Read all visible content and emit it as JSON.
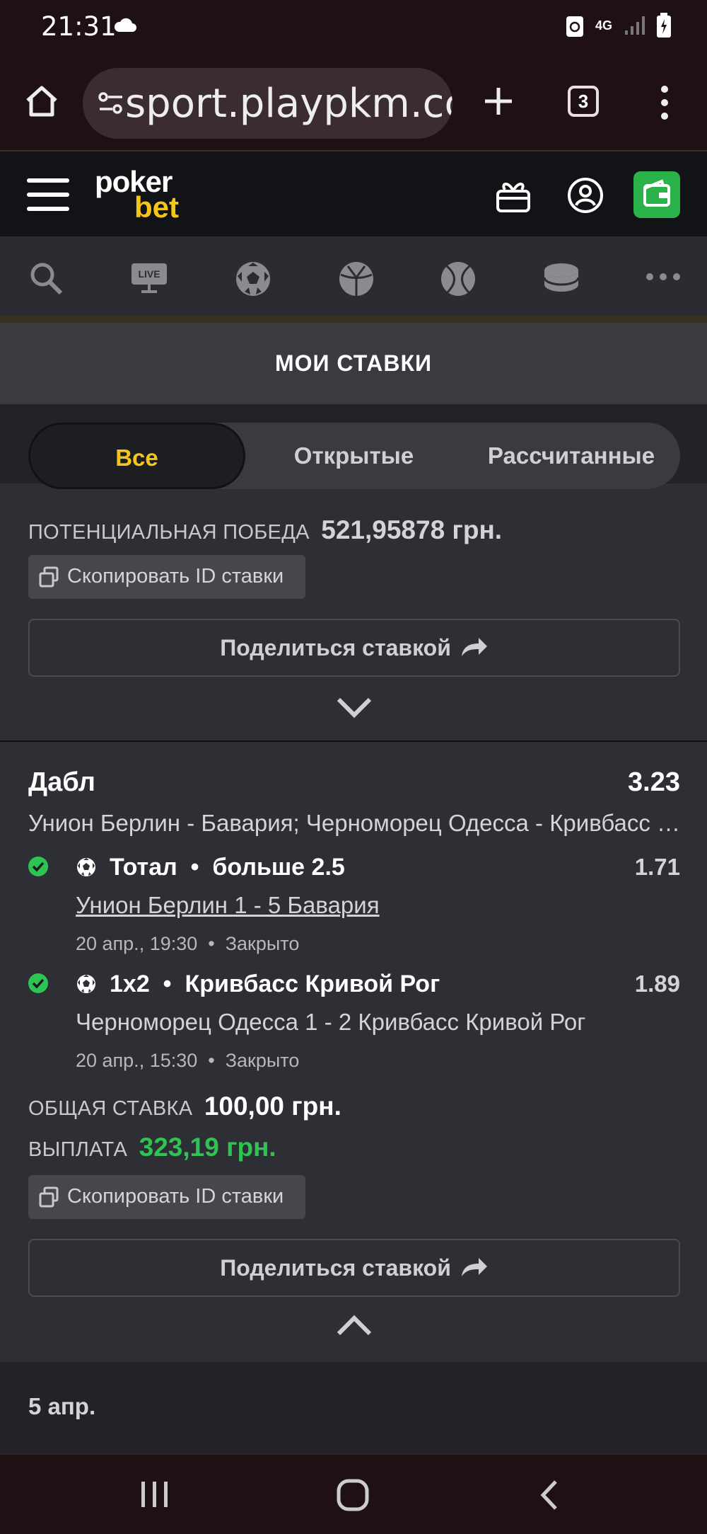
{
  "status_bar": {
    "time": "21:31",
    "network": "4G"
  },
  "browser": {
    "url": "sport.playpkm.cc",
    "tab_count": "3"
  },
  "site": {
    "logo_top": "poker",
    "logo_bottom": "bet"
  },
  "sport_nav": {
    "live_label": "LIVE"
  },
  "modal": {
    "title": "МОИ СТАВКИ",
    "tabs": [
      {
        "label": "Все",
        "active": true
      },
      {
        "label": "Открытые",
        "active": false
      },
      {
        "label": "Рассчитанные",
        "active": false
      }
    ]
  },
  "prev_bet": {
    "potential_win_label": "ПОТЕНЦИАЛЬНАЯ ПОБЕДА",
    "potential_win_value": "521,95878 грн.",
    "copy_id_label": "Скопировать ID ставки",
    "share_label": "Поделиться ставкой"
  },
  "bet": {
    "type": "Дабл",
    "odds": "3.23",
    "events": "Унион Берлин - Бавария; Черноморец Одесса - Кривбасс Кривой Рог",
    "selections": [
      {
        "market": "Тотал",
        "pick": "больше 2.5",
        "odd": "1.71",
        "match": "Унион Берлин 1 - 5 Бавария",
        "date": "20 апр., 19:30",
        "status": "Закрыто"
      },
      {
        "market": "1x2",
        "pick": "Кривбасс Кривой Рог",
        "odd": "1.89",
        "match": "Черноморец Одесса 1 - 2 Кривбасс Кривой Рог",
        "date": "20 апр., 15:30",
        "status": "Закрыто"
      }
    ],
    "stake_label": "ОБЩАЯ СТАВКА",
    "stake_value": "100,00 грн.",
    "payout_label": "ВЫПЛАТА",
    "payout_value": "323,19 грн.",
    "copy_id_label": "Скопировать ID ставки",
    "share_label": "Поделиться ставкой"
  },
  "date_group": "5 апр.",
  "colors": {
    "accent": "#f5c518",
    "success": "#2ec454",
    "wallet": "#29b34a"
  }
}
